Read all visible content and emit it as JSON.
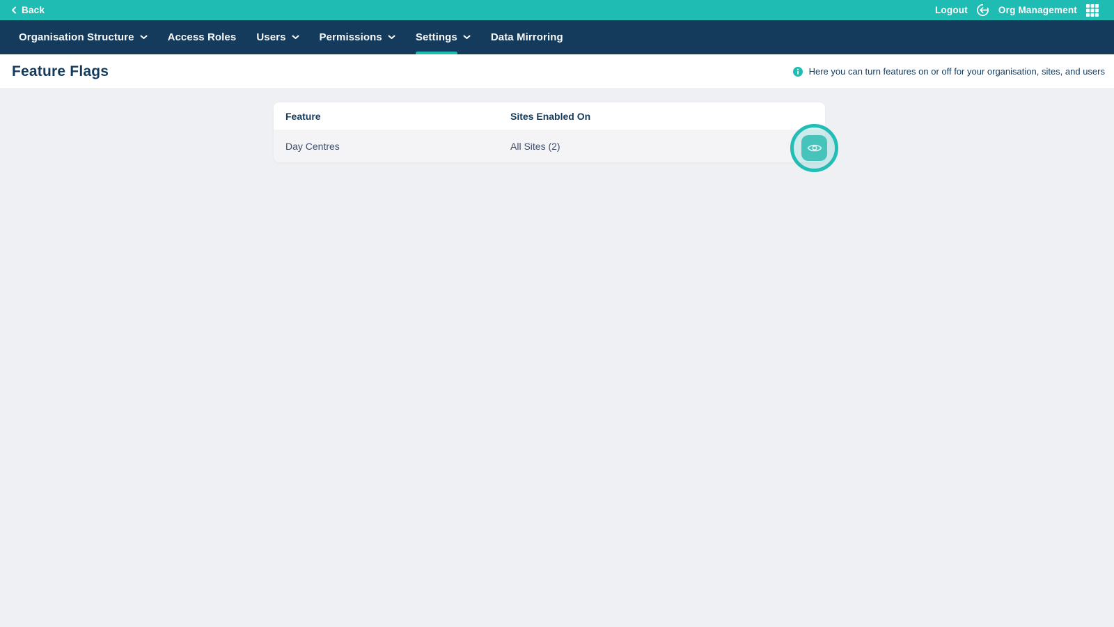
{
  "colors": {
    "accent_teal": "#1fbcb4",
    "navy": "#143a5c",
    "page_background": "#eff0f3",
    "table_row_background": "#f4f4f7",
    "eye_button_teal": "#4fc5bb"
  },
  "topbar": {
    "back_label": "Back",
    "logout_label": "Logout",
    "org_management_label": "Org Management"
  },
  "nav": {
    "items": [
      {
        "label": "Organisation Structure",
        "has_dropdown": true,
        "active": false
      },
      {
        "label": "Access Roles",
        "has_dropdown": false,
        "active": false
      },
      {
        "label": "Users",
        "has_dropdown": true,
        "active": false
      },
      {
        "label": "Permissions",
        "has_dropdown": true,
        "active": false
      },
      {
        "label": "Settings",
        "has_dropdown": true,
        "active": true
      },
      {
        "label": "Data Mirroring",
        "has_dropdown": false,
        "active": false
      }
    ]
  },
  "page": {
    "title": "Feature Flags",
    "info_text": "Here you can turn features on or off for your organisation, sites, and users"
  },
  "table": {
    "columns": [
      "Feature",
      "Sites Enabled On"
    ],
    "rows": [
      {
        "feature": "Day Centres",
        "sites_enabled_on": "All Sites (2)"
      }
    ]
  },
  "icons": {
    "back": "chevron-left",
    "logout": "arrow-left-circle",
    "org_apps": "grid-3x3",
    "info": "info-circle-filled",
    "dropdown": "chevron-down",
    "row_action": "eye"
  }
}
